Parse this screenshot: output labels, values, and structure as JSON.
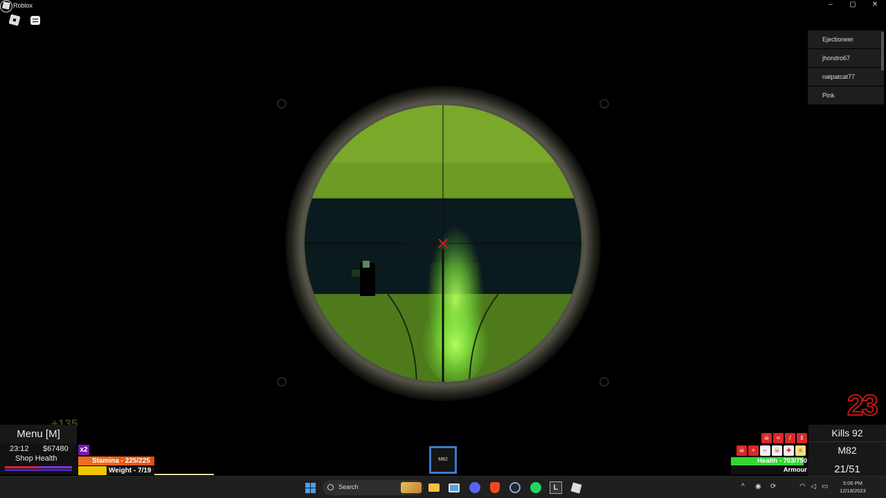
{
  "window": {
    "title": "Roblox",
    "controls": [
      "–",
      "▢",
      "✕"
    ]
  },
  "roblox": {
    "more_label": "···"
  },
  "playerlist": [
    "Ejectioneer",
    "jhondro67",
    "natpatcat77",
    "Pink"
  ],
  "hud": {
    "menu_label": "Menu [M]",
    "score_gain": "+135",
    "time": "23:12",
    "money": "$67480",
    "shop_health_label": "Shop Health",
    "multiplier": "x2",
    "stamina_label": "Stamina - 225/225",
    "weight_label": "Weight - 7/19",
    "weight_fraction": 0.37,
    "hotbar_slot": "M82",
    "ammo_counter": "23",
    "health_label": "Health - 703/750",
    "health_fraction": 0.937,
    "armour_label": "Armour",
    "kills_label": "Kills 92",
    "weapon_name": "M82",
    "magazine": "21/51"
  },
  "taskbar": {
    "search_label": "Search",
    "apps": [
      "file-explorer",
      "photos",
      "discord",
      "brave",
      "steam",
      "spotify",
      "launcher",
      "roblox"
    ],
    "launcher_letter": "L",
    "tray_arrow": "^",
    "clock_time": "5:06 PM",
    "clock_date": "12/18/2023"
  },
  "colors": {
    "scope_green": "#8ec22a",
    "health_green": "#32d832",
    "stamina_orange": "#f07020",
    "weight_yellow": "#f0c400",
    "ammo_red": "#c01818",
    "hotbar_blue": "#3a7ad0"
  }
}
